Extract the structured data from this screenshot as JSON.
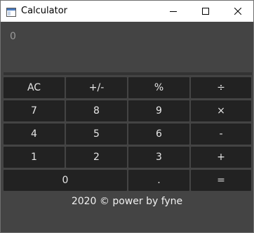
{
  "window": {
    "title": "Calculator"
  },
  "display": {
    "value": "0"
  },
  "keypad": {
    "ac": "AC",
    "sign": "+/-",
    "percent": "%",
    "divide": "÷",
    "seven": "7",
    "eight": "8",
    "nine": "9",
    "multiply": "×",
    "four": "4",
    "five": "5",
    "six": "6",
    "minus": "-",
    "one": "1",
    "two": "2",
    "three": "3",
    "plus": "+",
    "zero": "0",
    "dot": ".",
    "equals": "="
  },
  "footer": {
    "text": "2020 © power by fyne"
  }
}
